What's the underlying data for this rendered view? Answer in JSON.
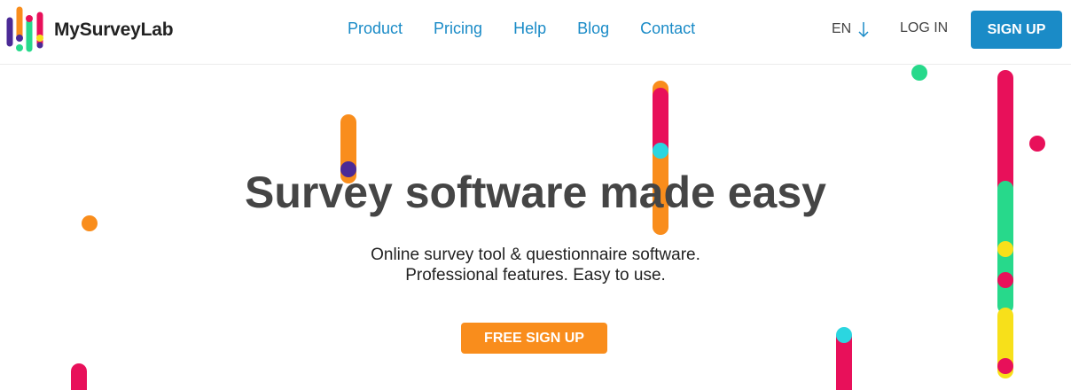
{
  "brand": {
    "name": "MySurveyLab"
  },
  "nav": {
    "items": [
      {
        "label": "Product"
      },
      {
        "label": "Pricing"
      },
      {
        "label": "Help"
      },
      {
        "label": "Blog"
      },
      {
        "label": "Contact"
      }
    ]
  },
  "language": {
    "label": "EN",
    "icon": "arrow-down-icon"
  },
  "auth": {
    "login_label": "LOG IN",
    "signup_label": "SIGN UP"
  },
  "hero": {
    "title": "Survey software made easy",
    "subtitle_line1": "Online survey tool & questionnaire software.",
    "subtitle_line2": "Professional features. Easy to use.",
    "cta_label": "FREE SIGN UP"
  },
  "colors": {
    "accent_blue": "#1a8bc7",
    "cta_orange": "#f98d1c",
    "pink": "#e8105a",
    "green": "#27d98b",
    "yellow": "#f7e01a",
    "cyan": "#2bd6e0",
    "purple": "#4b2a96",
    "title_gray": "#454545"
  }
}
